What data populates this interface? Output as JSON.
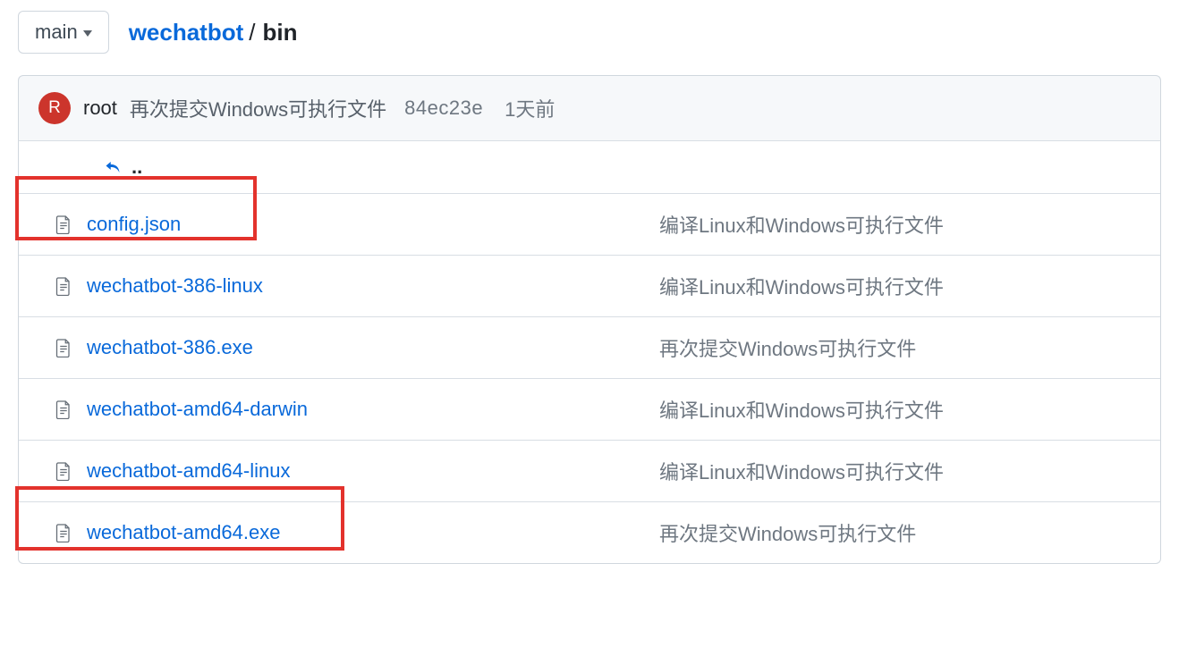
{
  "branch": "main",
  "breadcrumb": {
    "repo": "wechatbot",
    "dir": "bin",
    "sep": "/"
  },
  "avatar_letter": "R",
  "committer": "root",
  "commit_msg": "再次提交Windows可执行文件",
  "commit_hash": "84ec23e",
  "commit_time": "1天前",
  "back_dots": "..",
  "files": [
    {
      "name": "config.json",
      "msg": "编译Linux和Windows可执行文件",
      "highlight": 1
    },
    {
      "name": "wechatbot-386-linux",
      "msg": "编译Linux和Windows可执行文件",
      "highlight": 0
    },
    {
      "name": "wechatbot-386.exe",
      "msg": "再次提交Windows可执行文件",
      "highlight": 0
    },
    {
      "name": "wechatbot-amd64-darwin",
      "msg": "编译Linux和Windows可执行文件",
      "highlight": 0
    },
    {
      "name": "wechatbot-amd64-linux",
      "msg": "编译Linux和Windows可执行文件",
      "highlight": 0
    },
    {
      "name": "wechatbot-amd64.exe",
      "msg": "再次提交Windows可执行文件",
      "highlight": 2
    }
  ]
}
